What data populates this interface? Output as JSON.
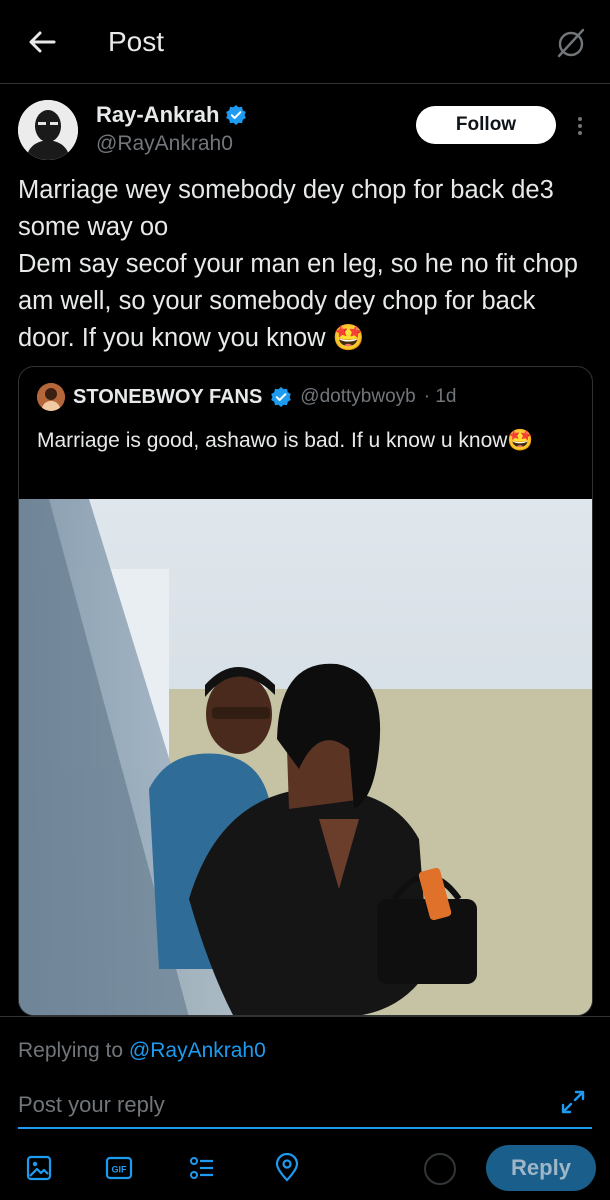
{
  "header": {
    "title": "Post",
    "back_icon": "arrow-left-icon",
    "right_icon": "grok-icon"
  },
  "author": {
    "name": "Ray-Ankrah",
    "handle": "@RayAnkrah0",
    "verified": true,
    "follow_label": "Follow"
  },
  "post": {
    "lines": [
      "Marriage wey somebody dey chop for back de3 some way oo",
      "Dem say secof your man en leg, so he no fit chop am well, so your somebody dey chop for back door. If you know you know 🤩"
    ]
  },
  "quote": {
    "name": "STONEBWOY FANS",
    "handle": "@dottybwoyb",
    "time": "· 1d",
    "verified": true,
    "text": "Marriage is good, ashawo is bad. If u know u know🤩"
  },
  "reply": {
    "replying_prefix": "Replying to ",
    "replying_handle": "@RayAnkrah0",
    "placeholder": "Post your reply",
    "button_label": "Reply"
  },
  "colors": {
    "accent": "#1d9bf0",
    "background": "#000000",
    "text": "#e7e9ea",
    "muted": "#71767b"
  }
}
